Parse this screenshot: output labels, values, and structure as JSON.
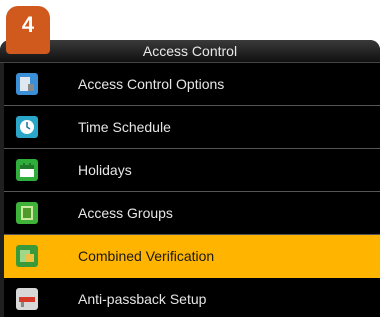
{
  "step_badge": "4",
  "screen": {
    "title": "Access Control"
  },
  "menu": {
    "items": [
      {
        "label": "Access Control Options",
        "icon": "access-options-icon"
      },
      {
        "label": "Time Schedule",
        "icon": "clock-icon"
      },
      {
        "label": "Holidays",
        "icon": "calendar-icon"
      },
      {
        "label": "Access Groups",
        "icon": "group-icon"
      },
      {
        "label": "Combined Verification",
        "icon": "combined-verification-icon",
        "selected": true
      },
      {
        "label": "Anti-passback Setup",
        "icon": "anti-passback-icon"
      }
    ]
  },
  "colors": {
    "selected_row": "#ffb400",
    "badge": "#d05a1e",
    "screen_bg": "#000000"
  }
}
